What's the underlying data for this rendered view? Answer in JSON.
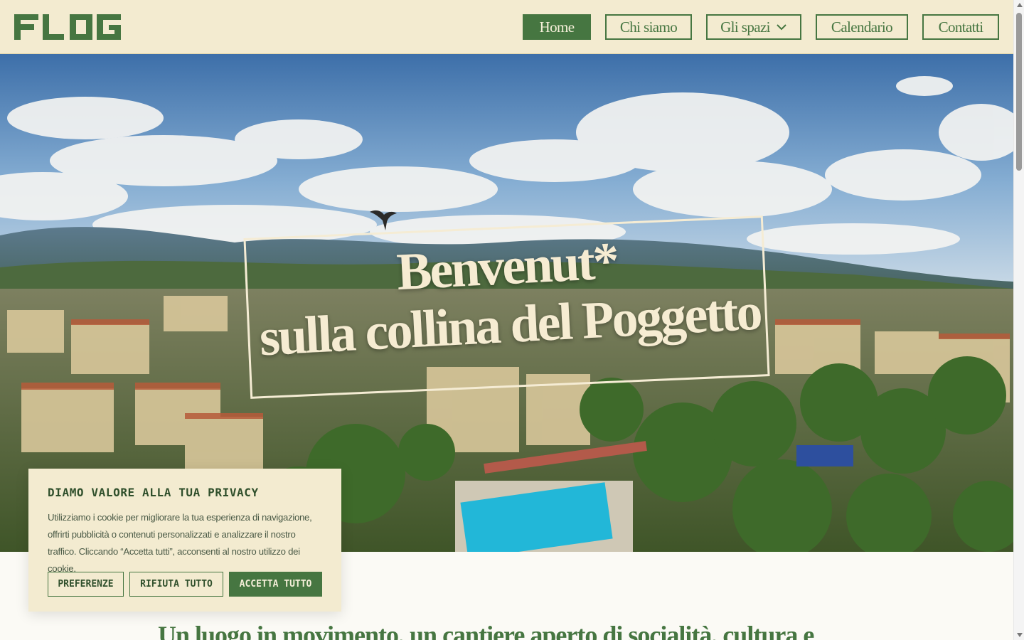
{
  "brand": {
    "logo_text": "FLOG",
    "color": "#467641",
    "header_bg": "#f3ebd0"
  },
  "nav": {
    "items": [
      {
        "label": "Home",
        "active": true
      },
      {
        "label": "Chi siamo",
        "active": false
      },
      {
        "label": "Gli spazi",
        "active": false,
        "dropdown": true,
        "icon": "chevron-down-icon"
      },
      {
        "label": "Calendario",
        "active": false
      },
      {
        "label": "Contatti",
        "active": false
      }
    ]
  },
  "hero": {
    "line1": "Benvenut*",
    "line2": "sulla collina del Poggetto",
    "image": "aerial-city-view-with-pool"
  },
  "cookie": {
    "title": "DIAMO VALORE ALLA TUA PRIVACY",
    "text": "Utilizziamo i cookie per migliorare la tua esperienza di navigazione, offrirti pubblicità o contenuti personalizzati e analizzare il nostro traffico. Cliccando “Accetta tutti”, acconsenti al nostro utilizzo dei cookie.",
    "buttons": {
      "preferences": "PREFERENZE",
      "reject": "RIFIUTA TUTTO",
      "accept": "ACCETTA TUTTO"
    }
  },
  "intro": {
    "text": "Un luogo in movimento, un cantiere aperto di socialità, cultura e"
  }
}
